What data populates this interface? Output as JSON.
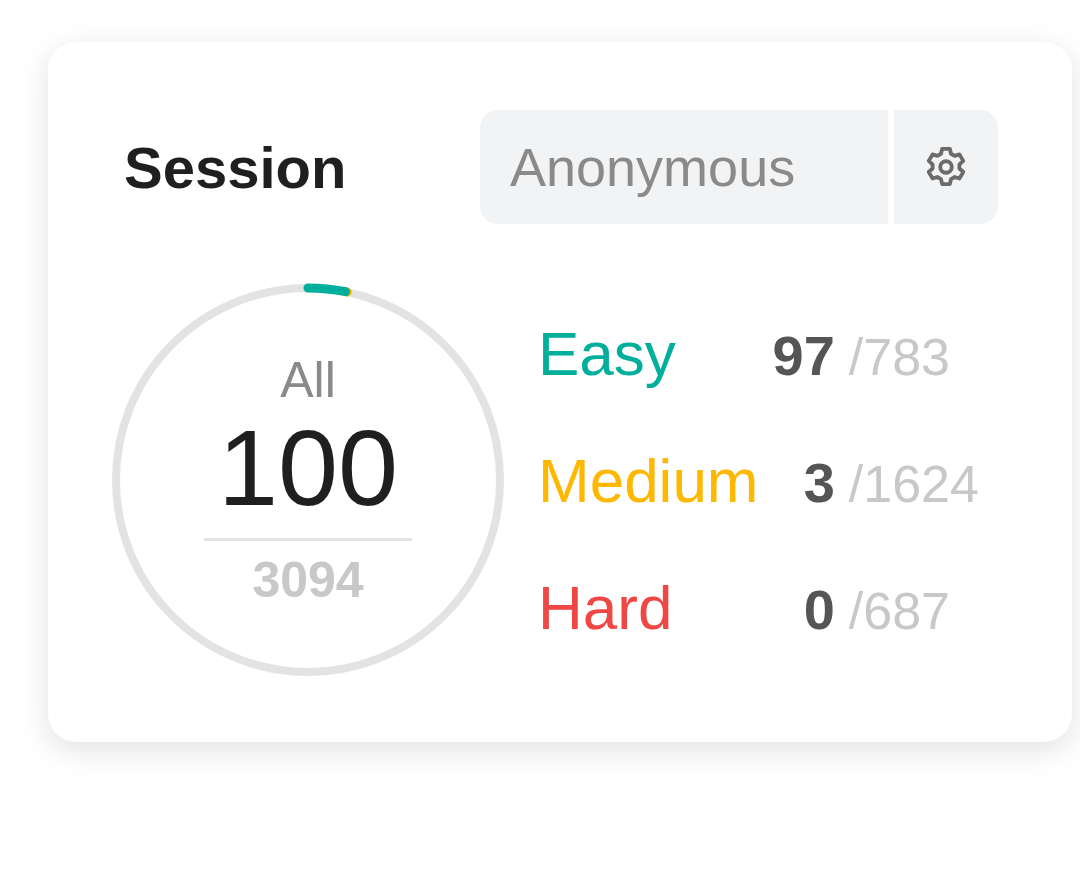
{
  "session": {
    "title": "Session",
    "dropdown": {
      "value": "Anonymous"
    }
  },
  "summary": {
    "label": "All",
    "solved": "100",
    "total": "3094"
  },
  "difficulties": [
    {
      "label": "Easy",
      "color": "#00af9b",
      "solved": "97",
      "total": "/783"
    },
    {
      "label": "Medium",
      "color": "#ffb800",
      "solved": "3",
      "total": "/1624"
    },
    {
      "label": "Hard",
      "color": "#ef4743",
      "solved": "0",
      "total": "/687"
    }
  ]
}
